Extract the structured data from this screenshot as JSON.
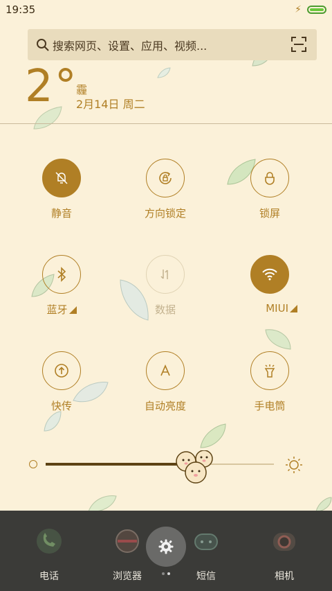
{
  "status": {
    "time": "19:35"
  },
  "search": {
    "placeholder": "搜索网页、设置、应用、视频..."
  },
  "weather": {
    "temp": "2°",
    "condition": "霾",
    "date": "2月14日 周二"
  },
  "tiles": [
    {
      "label": "静音",
      "icon": "bell-off-icon",
      "state": "active"
    },
    {
      "label": "方向锁定",
      "icon": "rotation-lock-icon",
      "state": "normal"
    },
    {
      "label": "锁屏",
      "icon": "lock-icon",
      "state": "normal"
    },
    {
      "label": "蓝牙",
      "icon": "bluetooth-icon",
      "state": "normal"
    },
    {
      "label": "数据",
      "icon": "mobile-data-icon",
      "state": "disabled"
    },
    {
      "label": "MIUI",
      "icon": "wifi-icon",
      "state": "active"
    },
    {
      "label": "快传",
      "icon": "transfer-icon",
      "state": "normal"
    },
    {
      "label": "自动亮度",
      "icon": "auto-brightness-icon",
      "state": "normal"
    },
    {
      "label": "手电筒",
      "icon": "flashlight-icon",
      "state": "normal"
    }
  ],
  "brightness": {
    "level": 0.65
  },
  "dock": [
    {
      "label": "电话",
      "icon": "phone-app-icon"
    },
    {
      "label": "浏览器",
      "icon": "browser-app-icon"
    },
    {
      "label": "短信",
      "icon": "messages-app-icon"
    },
    {
      "label": "相机",
      "icon": "camera-app-icon"
    }
  ],
  "colors": {
    "accent": "#b07f25",
    "background": "#fbf1d9",
    "dock": "#3b3b38"
  }
}
